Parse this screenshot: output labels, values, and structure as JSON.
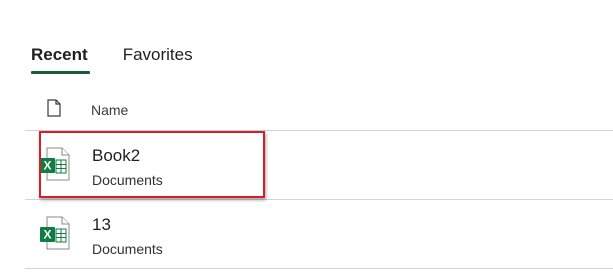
{
  "tabs": [
    {
      "label": "Recent",
      "active": true
    },
    {
      "label": "Favorites",
      "active": false
    }
  ],
  "list": {
    "header_name": "Name",
    "header_icon": "file-icon",
    "files": [
      {
        "name": "Book2",
        "location": "Documents",
        "icon": "excel-icon",
        "highlighted": true
      },
      {
        "name": "13",
        "location": "Documents",
        "icon": "excel-icon",
        "highlighted": false
      }
    ]
  },
  "colors": {
    "accent": "#185c37",
    "excel_green": "#107c41",
    "highlight": "#d32027"
  }
}
